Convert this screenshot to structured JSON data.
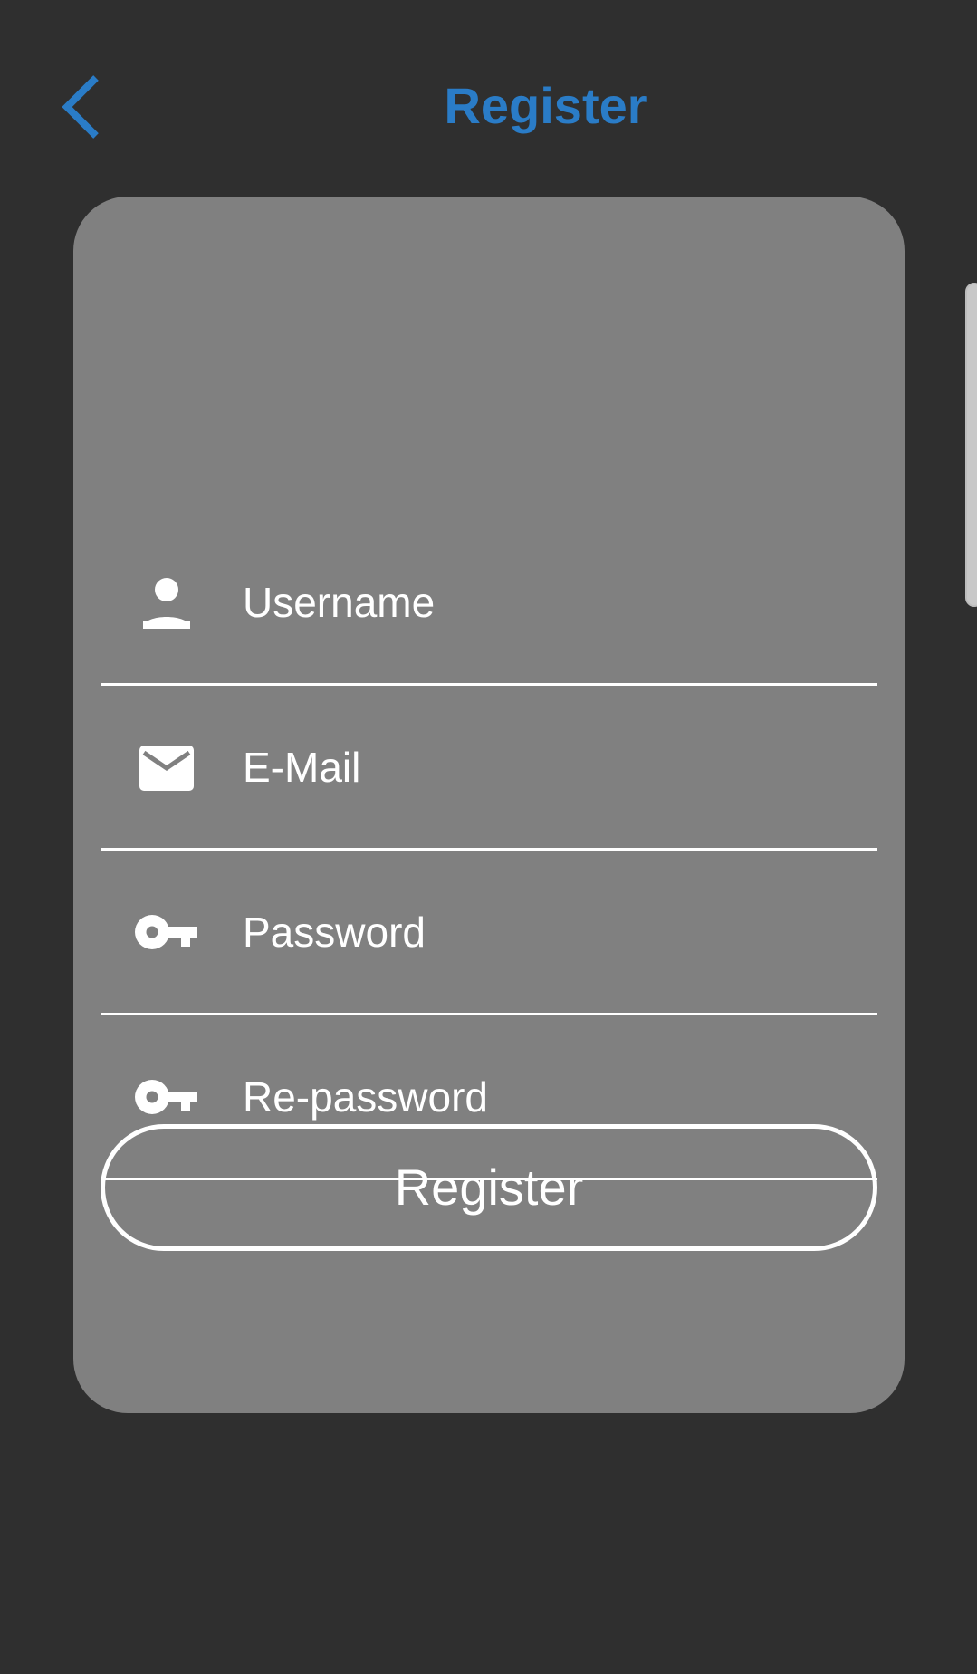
{
  "colors": {
    "background": "#2f2f2f",
    "card": "#808080",
    "accent": "#2a7cc7",
    "text": "#ffffff"
  },
  "header": {
    "title": "Register",
    "back_icon": "chevron-left-icon"
  },
  "form": {
    "fields": [
      {
        "icon": "person-icon",
        "placeholder": "Username",
        "value": ""
      },
      {
        "icon": "mail-icon",
        "placeholder": "E-Mail",
        "value": ""
      },
      {
        "icon": "key-icon",
        "placeholder": "Password",
        "value": ""
      },
      {
        "icon": "key-icon",
        "placeholder": "Re-password",
        "value": ""
      }
    ],
    "submit_label": "Register"
  }
}
